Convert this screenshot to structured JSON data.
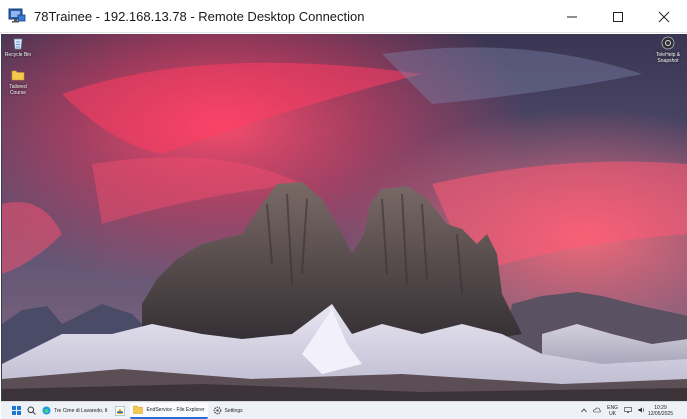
{
  "window": {
    "title": "78Trainee - 192.168.13.78 - Remote Desktop Connection",
    "controls": [
      "minimize",
      "maximize",
      "close"
    ]
  },
  "desktop": {
    "icons": [
      {
        "label": "Recycle Bin",
        "icon": "recycle-bin-icon"
      },
      {
        "label": "Tailored Course",
        "icon": "folder-icon"
      },
      {
        "label": "TeleHelp & Snapshot",
        "icon": "app-shortcut-icon"
      }
    ]
  },
  "taskbar": {
    "apps": [
      {
        "label": "Tre Cime di Lavaredo, It",
        "icon": "edge-icon",
        "active": false
      },
      {
        "label": "",
        "icon": "file-manager-icon",
        "active": false
      },
      {
        "label": "EndService - File Explorer",
        "icon": "folder-icon",
        "active": true
      },
      {
        "label": "Settings",
        "icon": "gear-icon",
        "active": false
      }
    ],
    "tray": {
      "language_top": "ENG",
      "language_bottom": "UK",
      "time": "10:29",
      "date": "12/05/2025"
    }
  },
  "colors": {
    "accent": "#2b6fd6",
    "taskbar_bg": "#eef1f6"
  }
}
